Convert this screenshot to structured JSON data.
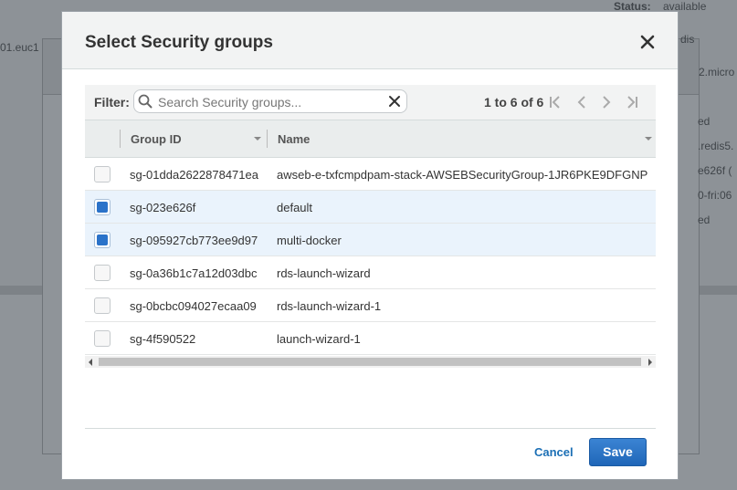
{
  "background": {
    "status_label": "Status:",
    "status_value": "available",
    "left_fragment": "01.euc1",
    "right_fragments": [
      "dis",
      "2.micro",
      "ed",
      ".redis5.",
      "e626f (",
      "0-fri:06",
      "ed"
    ]
  },
  "modal": {
    "title": "Select Security groups",
    "filter_label": "Filter:",
    "search_placeholder": "Search Security groups...",
    "pager_text": "1 to 6 of 6",
    "columns": [
      "Group ID",
      "Name"
    ],
    "rows": [
      {
        "group_id": "sg-01dda2622878471ea",
        "name": "awseb-e-txfcmpdpam-stack-AWSEBSecurityGroup-1JR6PKE9DFGNP",
        "selected": false
      },
      {
        "group_id": "sg-023e626f",
        "name": "default",
        "selected": true
      },
      {
        "group_id": "sg-095927cb773ee9d97",
        "name": "multi-docker",
        "selected": true
      },
      {
        "group_id": "sg-0a36b1c7a12d03dbc",
        "name": "rds-launch-wizard",
        "selected": false
      },
      {
        "group_id": "sg-0bcbc094027ecaa09",
        "name": "rds-launch-wizard-1",
        "selected": false
      },
      {
        "group_id": "sg-4f590522",
        "name": "launch-wizard-1",
        "selected": false
      }
    ],
    "cancel_label": "Cancel",
    "save_label": "Save"
  },
  "colors": {
    "accent": "#2a72c9",
    "link": "#1b6fb5",
    "selected_row": "#eaf3fc"
  },
  "icons": {
    "close": "close-icon",
    "search": "search-icon",
    "clear": "clear-icon",
    "first": "first-page-icon",
    "prev": "prev-page-icon",
    "next": "next-page-icon",
    "last": "last-page-icon"
  }
}
